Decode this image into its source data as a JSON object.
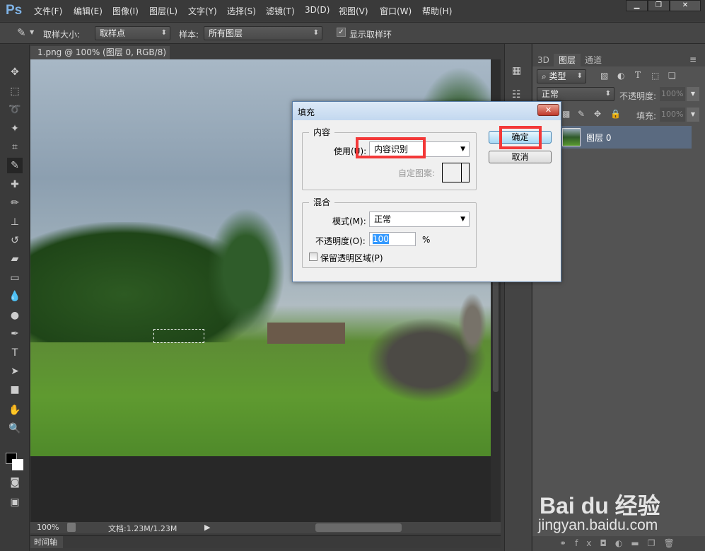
{
  "app": {
    "logo": "Ps"
  },
  "menu": [
    "文件(F)",
    "编辑(E)",
    "图像(I)",
    "图层(L)",
    "文字(Y)",
    "选择(S)",
    "滤镜(T)",
    "3D(D)",
    "视图(V)",
    "窗口(W)",
    "帮助(H)"
  ],
  "window_controls": {
    "minimize": "▁",
    "restore": "❐",
    "close": "✕"
  },
  "options": {
    "sample_size_label": "取样大小:",
    "sample_size_value": "取样点",
    "sample_label": "样本:",
    "sample_value": "所有图层",
    "show_ring_label": "显示取样环",
    "show_ring_checked": true
  },
  "document": {
    "tab_title": "1.png @ 100% (图层 0, RGB/8)",
    "close": "×",
    "zoom": "100%",
    "doc_info": "文档:1.23M/1.23M"
  },
  "timeline": {
    "label": "时间轴"
  },
  "layers_panel": {
    "tabs": [
      "3D",
      "图层",
      "通道"
    ],
    "active_tab": "图层",
    "filter_label": "类型",
    "blend_mode": "正常",
    "opacity_label": "不透明度:",
    "opacity": "100%",
    "fill_label": "填充:",
    "fill": "100%",
    "layers": [
      {
        "name": "图层 0"
      }
    ]
  },
  "dialog": {
    "title": "填充",
    "contents_legend": "内容",
    "use_label": "使用(U):",
    "use_value": "内容识别",
    "custom_pattern_label": "自定图案:",
    "blending_legend": "混合",
    "mode_label": "模式(M):",
    "mode_value": "正常",
    "opacity_label": "不透明度(O):",
    "opacity_value": "100",
    "percent": "%",
    "preserve_label": "保留透明区域(P)",
    "preserve_checked": false,
    "ok": "确定",
    "cancel": "取消",
    "highlight_color": "#f33838"
  },
  "watermark": {
    "brand": "Bai du 经验",
    "url": "jingyan.baidu.com"
  }
}
